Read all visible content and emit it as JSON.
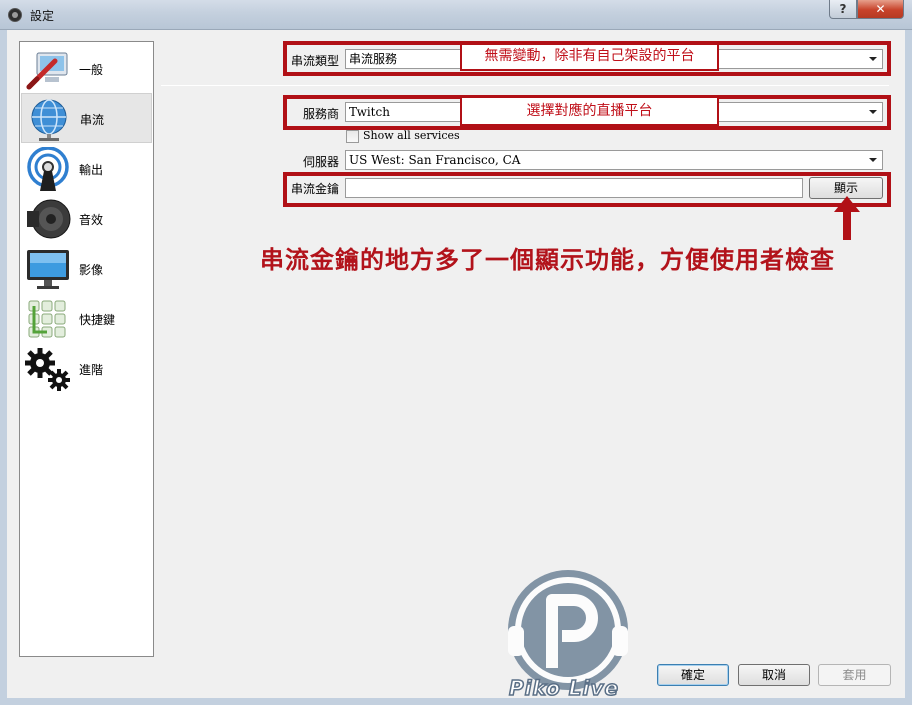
{
  "window": {
    "title": "設定",
    "help_label": "?",
    "close_label": "✕"
  },
  "sidebar": {
    "items": [
      {
        "label": "一般",
        "icon": "general-settings-icon"
      },
      {
        "label": "串流",
        "icon": "stream-globe-icon",
        "selected": true
      },
      {
        "label": "輸出",
        "icon": "output-broadcast-icon"
      },
      {
        "label": "音效",
        "icon": "audio-speaker-icon"
      },
      {
        "label": "影像",
        "icon": "video-monitor-icon"
      },
      {
        "label": "快捷鍵",
        "icon": "hotkeys-keyboard-icon"
      },
      {
        "label": "進階",
        "icon": "advanced-gears-icon"
      }
    ]
  },
  "stream": {
    "type_label": "串流類型",
    "type_value": "串流服務",
    "service_label": "服務商",
    "service_value": "Twitch",
    "show_all_label": "Show all services",
    "server_label": "伺服器",
    "server_value": "US West: San Francisco, CA",
    "key_label": "串流金鑰",
    "key_value": "",
    "show_button": "顯示"
  },
  "annotations": {
    "note1": "無需變動，除非有自己架設的平台",
    "note2": "選擇對應的直播平台",
    "main_text": "串流金鑰的地方多了一個顯示功能，方便使用者檢查",
    "color": "#b11016"
  },
  "footer": {
    "ok": "確定",
    "cancel": "取消",
    "apply": "套用"
  },
  "watermark": {
    "text": "Piko Live"
  }
}
